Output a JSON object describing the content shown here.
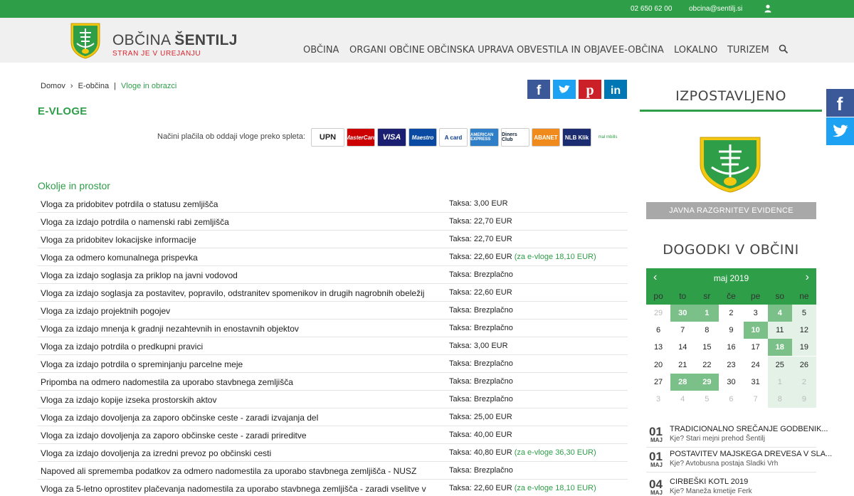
{
  "topbar": {
    "phone": "02 650 62 00",
    "email": "obcina@sentilj.si",
    "user_icon": "user-icon"
  },
  "header": {
    "brand_prefix": "OBČINA ",
    "brand_name": "ŠENTILJ",
    "brand_sub": "STRAN JE V UREJANJU",
    "nav": [
      "OBČINA",
      "ORGANI OBČINE",
      "OBČINSKA UPRAVA",
      "OBVESTILA IN OBJAVE",
      "E-OBČINA",
      "LOKALNO",
      "TURIZEM"
    ],
    "search_icon": "search-icon"
  },
  "breadcrumb": {
    "home": "Domov",
    "sep1": "›",
    "section": "E-občina",
    "sep2": "|",
    "current": "Vloge in obrazci"
  },
  "page": {
    "title": "E-VLOGE",
    "payment_label": "Načini plačila ob oddaji vloge preko spleta:",
    "payment_methods": [
      "UPN",
      "MasterCard",
      "VISA",
      "Maestro",
      "A card",
      "AMERICAN EXPRESS",
      "Diners Club",
      "ABANET",
      "NLB Klik",
      "mal mbills"
    ],
    "section_title": "Okolje in prostor"
  },
  "forms": [
    {
      "name": "Vloga za pridobitev potrdila o statusu zemljišča",
      "fee": "Taksa: 3,00 EUR",
      "online": ""
    },
    {
      "name": "Vloga za izdajo potrdila o namenski rabi zemljišča",
      "fee": "Taksa: 22,70 EUR",
      "online": ""
    },
    {
      "name": "Vloga za pridobitev lokacijske informacije",
      "fee": "Taksa: 22,70 EUR",
      "online": ""
    },
    {
      "name": "Vloga za odmero komunalnega prispevka",
      "fee": "Taksa: 22,60 EUR",
      "online": "(za e-vloge 18,10 EUR)"
    },
    {
      "name": "Vloga za izdajo soglasja za priklop na javni vodovod",
      "fee": "Taksa: Brezplačno",
      "online": ""
    },
    {
      "name": "Vloga za izdajo soglasja za postavitev, popravilo, odstranitev spomenikov in drugih nagrobnih obeležij",
      "fee": "Taksa: 22,60 EUR",
      "online": ""
    },
    {
      "name": "Vloga za izdajo projektnih pogojev",
      "fee": "Taksa: Brezplačno",
      "online": ""
    },
    {
      "name": "Vloga za izdajo mnenja k gradnji nezahtevnih in enostavnih objektov",
      "fee": "Taksa: Brezplačno",
      "online": ""
    },
    {
      "name": "Vloga za izdajo potrdila o predkupni pravici",
      "fee": "Taksa: 3,00 EUR",
      "online": ""
    },
    {
      "name": "Vloga za izdajo potrdila o spreminjanju parcelne meje",
      "fee": "Taksa: Brezplačno",
      "online": ""
    },
    {
      "name": "Pripomba na odmero nadomestila za uporabo stavbnega zemljišča",
      "fee": "Taksa: Brezplačno",
      "online": ""
    },
    {
      "name": "Vloga za izdajo kopije izseka prostorskih aktov",
      "fee": "Taksa: Brezplačno",
      "online": ""
    },
    {
      "name": "Vloga za izdajo dovoljenja za zaporo občinske ceste - zaradi izvajanja del",
      "fee": "Taksa: 25,00 EUR",
      "online": ""
    },
    {
      "name": "Vloga za izdajo dovoljenja za zaporo občinske ceste - zaradi prireditve",
      "fee": "Taksa: 40,00 EUR",
      "online": ""
    },
    {
      "name": "Vloga za izdajo dovoljenja za izredni prevoz po občinski cesti",
      "fee": "Taksa: 40,80 EUR",
      "online": "(za e-vloge 36,30 EUR)"
    },
    {
      "name": "Napoved ali sprememba podatkov za odmero nadomestila za uporabo stavbnega zemljišča - NUSZ",
      "fee": "Taksa: Brezplačno",
      "online": ""
    },
    {
      "name": "Vloga za 5-letno oprostitev plačevanja nadomestila za uporabo stavbnega zemljišča - zaradi vselitve v",
      "fee": "Taksa: 22,60 EUR",
      "online": "(za e-vloge 18,10 EUR)"
    }
  ],
  "sidebar": {
    "featured_title": "IZPOSTAVLJENO",
    "razgrnitev": "JAVNA RAZGRNITEV EVIDENCE",
    "events_title": "DOGODKI V OBČINI",
    "calendar": {
      "month": "maj 2019",
      "prev": "‹",
      "next": "›",
      "dow": [
        "po",
        "to",
        "sr",
        "če",
        "pe",
        "so",
        "ne"
      ],
      "weeks": [
        [
          "29",
          "30",
          "1",
          "2",
          "3",
          "4",
          "5"
        ],
        [
          "6",
          "7",
          "8",
          "9",
          "10",
          "11",
          "12"
        ],
        [
          "13",
          "14",
          "15",
          "16",
          "17",
          "18",
          "19"
        ],
        [
          "20",
          "21",
          "22",
          "23",
          "24",
          "25",
          "26"
        ],
        [
          "27",
          "28",
          "29",
          "30",
          "31",
          "1",
          "2"
        ],
        [
          "3",
          "4",
          "5",
          "6",
          "7",
          "8",
          "9"
        ]
      ],
      "muted": [
        [
          0,
          0
        ],
        [
          4,
          5
        ],
        [
          4,
          6
        ],
        [
          5,
          0
        ],
        [
          5,
          1
        ],
        [
          5,
          2
        ],
        [
          5,
          3
        ],
        [
          5,
          4
        ],
        [
          5,
          5
        ],
        [
          5,
          6
        ]
      ],
      "events": [
        [
          0,
          1
        ],
        [
          0,
          2
        ],
        [
          0,
          5
        ],
        [
          1,
          4
        ],
        [
          2,
          5
        ],
        [
          4,
          1
        ],
        [
          4,
          2
        ]
      ]
    },
    "events": [
      {
        "day": "01",
        "month": "MAJ",
        "title": "TRADICIONALNO SREČANJE GODBENIK...",
        "location": "Kje? Stari mejni prehod Šentilj"
      },
      {
        "day": "01",
        "month": "MAJ",
        "title": "POSTAVITEV MAJSKEGA DREVESA V SLA...",
        "location": "Kje? Avtobusna postaja Sladki Vrh"
      },
      {
        "day": "04",
        "month": "MAJ",
        "title": "CIRBEŠKI KOTL 2019",
        "location": "Kje? Maneža kmetije Ferk"
      }
    ]
  },
  "colors": {
    "brand_green": "#2e9e48",
    "accent_red": "#d8242b"
  }
}
